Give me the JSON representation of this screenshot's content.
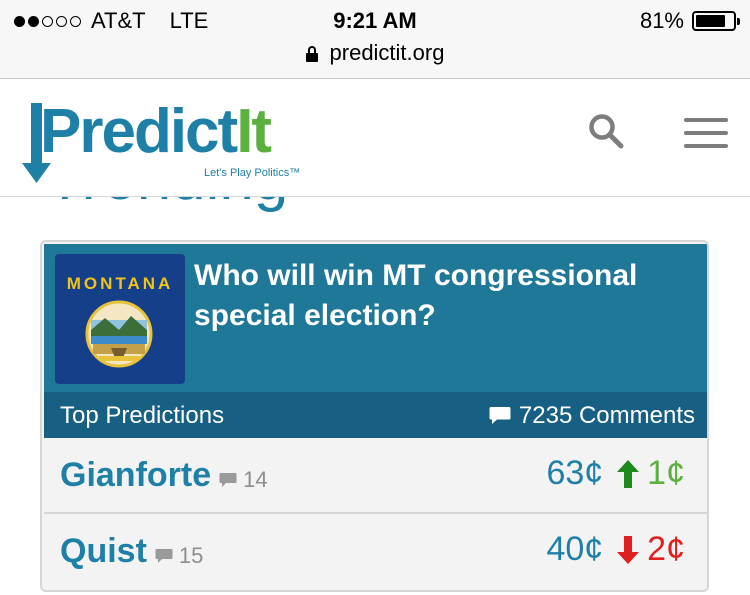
{
  "status_bar": {
    "signal_full": 2,
    "signal_total": 5,
    "carrier": "AT&T",
    "network": "LTE",
    "time": "9:21 AM",
    "battery": "81%",
    "battery_level": 0.81
  },
  "browser": {
    "url": "predictit.org"
  },
  "header": {
    "logo_predict": "Predict",
    "logo_it": "It",
    "logo_tagline": "Let's Play Politics™",
    "icons": [
      "search-icon",
      "menu-icon"
    ]
  },
  "section": {
    "title": "Trending"
  },
  "market": {
    "flag_label": "MONTANA",
    "question": "Who will win MT congressional special election?",
    "top_predictions_label": "Top Predictions",
    "comments": "7235 Comments",
    "contracts": [
      {
        "name": "Gianforte",
        "comments": "14",
        "price": "63¢",
        "direction": "up",
        "change": "1¢",
        "change_color": "#5bb040"
      },
      {
        "name": "Quist",
        "comments": "15",
        "price": "40¢",
        "direction": "down",
        "change": "2¢",
        "change_color": "#e02020"
      }
    ]
  },
  "colors": {
    "brand_blue": "#1e7fa7",
    "brand_green": "#5bb040",
    "card_header": "#1f7898",
    "predictions_bar": "#176083",
    "down_red": "#e02020"
  }
}
